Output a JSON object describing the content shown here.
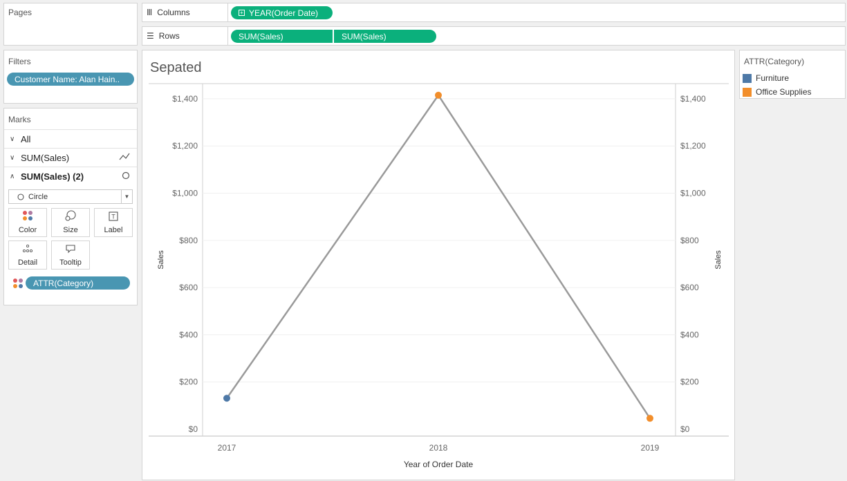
{
  "pages": {
    "title": "Pages"
  },
  "shelves": {
    "columns_label": "Columns",
    "rows_label": "Rows",
    "columns_pills": [
      "YEAR(Order Date)"
    ],
    "rows_pills": [
      "SUM(Sales)",
      "SUM(Sales)"
    ]
  },
  "filters": {
    "title": "Filters",
    "pills": [
      "Customer Name: Alan Hain.."
    ]
  },
  "marks": {
    "title": "Marks",
    "rows": [
      "All",
      "SUM(Sales)",
      "SUM(Sales) (2)"
    ],
    "mark_type": "Circle",
    "buttons": [
      "Color",
      "Size",
      "Label",
      "Detail",
      "Tooltip"
    ],
    "color_pill": "ATTR(Category)"
  },
  "legend": {
    "title": "ATTR(Category)",
    "items": [
      {
        "label": "Furniture",
        "color": "#4e79a7"
      },
      {
        "label": "Office Supplies",
        "color": "#f28e2b"
      }
    ]
  },
  "sheet": {
    "title": "Sepated"
  },
  "chart_data": {
    "type": "line",
    "title": "Sepated",
    "xlabel": "Year of Order Date",
    "ylabel_left": "Sales",
    "ylabel_right": "Sales",
    "categories": [
      "2017",
      "2018",
      "2019"
    ],
    "ylim": [
      0,
      1500
    ],
    "y_ticks": [
      "$0",
      "$200",
      "$400",
      "$600",
      "$800",
      "$1,000",
      "$1,200",
      "$1,400"
    ],
    "y_tick_values": [
      0,
      200,
      400,
      600,
      800,
      1000,
      1200,
      1400
    ],
    "line_color": "#9a9a9a",
    "series": [
      {
        "values": [
          131,
          1415,
          46
        ]
      }
    ],
    "points": [
      {
        "x": "2017",
        "y": 131,
        "category": "Furniture",
        "color": "#4e79a7"
      },
      {
        "x": "2018",
        "y": 1415,
        "category": "Office Supplies",
        "color": "#f28e2b"
      },
      {
        "x": "2019",
        "y": 46,
        "category": "Office Supplies",
        "color": "#f28e2b"
      }
    ]
  }
}
